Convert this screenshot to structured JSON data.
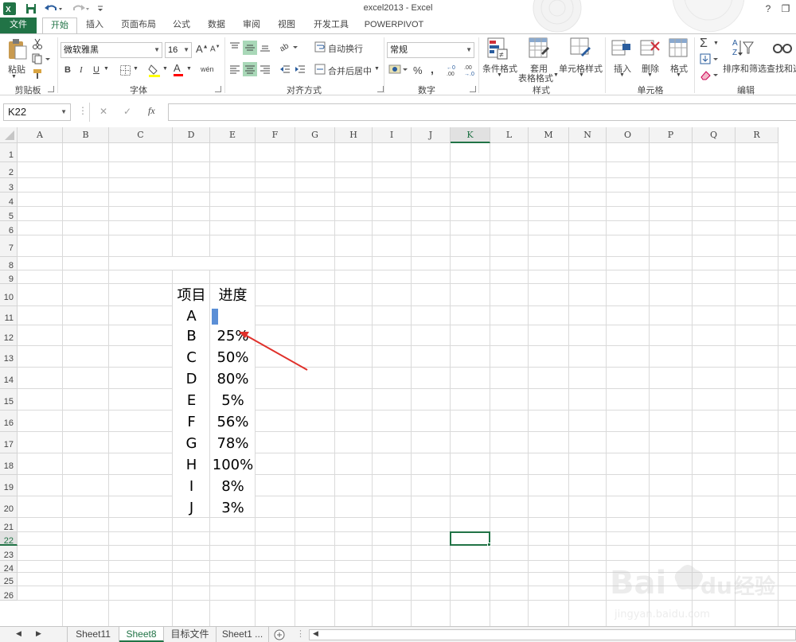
{
  "window": {
    "title": "excel2013 - Excel",
    "help_label": "?",
    "min_label": "—",
    "restore_label": "❐"
  },
  "tabs": [
    {
      "label": "文件"
    },
    {
      "label": "开始"
    },
    {
      "label": "插入"
    },
    {
      "label": "页面布局"
    },
    {
      "label": "公式"
    },
    {
      "label": "数据"
    },
    {
      "label": "审阅"
    },
    {
      "label": "视图"
    },
    {
      "label": "开发工具"
    },
    {
      "label": "POWERPIVOT"
    }
  ],
  "ribbon": {
    "clipboard": {
      "paste_label": "粘贴",
      "group_label": "剪贴板"
    },
    "font": {
      "font_name": "微软雅黑",
      "font_size": "16",
      "bold": "B",
      "italic": "I",
      "underline": "U",
      "grow": "A",
      "shrink": "A",
      "color_glyph": "A",
      "phonetic_glyph": "wén",
      "group_label": "字体",
      "font_color": "#ff0000",
      "fill_color": "#ffff00"
    },
    "alignment": {
      "wrap_text_label": "自动换行",
      "merge_center_label": "合并后居中",
      "group_label": "对齐方式"
    },
    "number": {
      "format_value": "常规",
      "percent": "%",
      "comma": ",",
      "inc_decimal": "←0\n.00",
      "dec_decimal": ".00\n→.0",
      "group_label": "数字"
    },
    "styles": {
      "conditional_format_label": "条件格式",
      "table_format_label_1": "套用",
      "table_format_label_2": "表格格式",
      "cell_styles_label": "单元格样式",
      "group_label": "样式"
    },
    "cells": {
      "insert_label": "插入",
      "delete_label": "删除",
      "format_label": "格式",
      "group_label": "单元格"
    },
    "editing": {
      "sum_glyph": "Σ",
      "sort_filter_label": "排序和筛选",
      "find_select_label": "查找和选",
      "group_label": "编辑"
    }
  },
  "formula_bar": {
    "name_box": "K22",
    "cancel_glyph": "✕",
    "enter_glyph": "✓",
    "fx_glyph": "fx",
    "formula": ""
  },
  "grid": {
    "columns": [
      "A",
      "B",
      "C",
      "D",
      "E",
      "F",
      "G",
      "H",
      "I",
      "J",
      "K",
      "L",
      "M",
      "N",
      "O",
      "P",
      "Q",
      "R"
    ],
    "rows": [
      "1",
      "2",
      "3",
      "4",
      "5",
      "6",
      "7",
      "8",
      "9",
      "10",
      "11",
      "12",
      "13",
      "14",
      "15",
      "16",
      "17",
      "18",
      "19",
      "20",
      "21",
      "22",
      "23",
      "24",
      "25",
      "26"
    ],
    "selected_cell": "K22",
    "table": {
      "header_item": "项目",
      "header_progress": "进度",
      "data_bar_color": "#5b8fd6",
      "rows": [
        {
          "item": "A",
          "progress": "",
          "progress_value": 0
        },
        {
          "item": "B",
          "progress": "25%",
          "progress_value": 0.25
        },
        {
          "item": "C",
          "progress": "50%",
          "progress_value": 0.5
        },
        {
          "item": "D",
          "progress": "80%",
          "progress_value": 0.8
        },
        {
          "item": "E",
          "progress": "5%",
          "progress_value": 0.05
        },
        {
          "item": "F",
          "progress": "56%",
          "progress_value": 0.56
        },
        {
          "item": "G",
          "progress": "78%",
          "progress_value": 0.78
        },
        {
          "item": "H",
          "progress": "100%",
          "progress_value": 1
        },
        {
          "item": "I",
          "progress": "8%",
          "progress_value": 0.08
        },
        {
          "item": "J",
          "progress": "3%",
          "progress_value": 0.03
        }
      ]
    }
  },
  "sheet_tabs": [
    {
      "label": "Sheet11",
      "active": false
    },
    {
      "label": "Sheet8",
      "active": true
    },
    {
      "label": "目标文件",
      "active": false
    },
    {
      "label": "Sheet1 ...",
      "active": false
    }
  ],
  "annotation": {
    "arrow_color": "#e0302a"
  },
  "watermark": {
    "brand": "Bai du",
    "product": "经验",
    "url": "jingyan.baidu.com"
  },
  "colors": {
    "excel_green": "#217346",
    "grid_line": "#dadada"
  }
}
